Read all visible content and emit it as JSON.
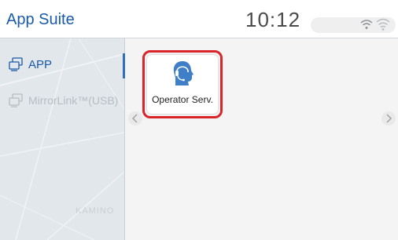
{
  "header": {
    "title": "App Suite",
    "clock": "10:12",
    "status_icons": [
      "wifi-icon",
      "wifi-off-icon"
    ]
  },
  "sidebar": {
    "items": [
      {
        "label": "APP",
        "icon": "app-list-icon",
        "active": true
      },
      {
        "label": "MirrorLink™(USB)",
        "icon": "mirrorlink-icon",
        "active": false
      }
    ],
    "map_text": "KAMINO"
  },
  "main": {
    "apps": [
      {
        "label": "Operator Serv.",
        "icon": "operator-headset-icon",
        "highlighted": true
      }
    ],
    "nav": {
      "prev_icon": "chevron-left-icon",
      "next_icon": "chevron-right-icon"
    }
  },
  "colors": {
    "accent": "#1a5aa8",
    "highlight": "#d9242a",
    "icon_blue": "#3f7fc8",
    "sidebar_bg": "#e2e7eb",
    "main_bg": "#f4f4f4"
  }
}
